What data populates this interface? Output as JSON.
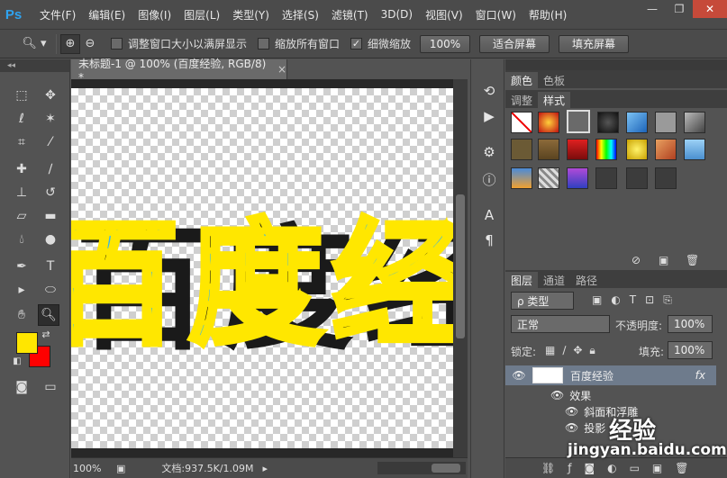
{
  "app": {
    "logo": "Ps",
    "menu": [
      "文件(F)",
      "编辑(E)",
      "图像(I)",
      "图层(L)",
      "类型(Y)",
      "选择(S)",
      "滤镜(T)",
      "3D(D)",
      "视图(V)",
      "窗口(W)",
      "帮助(H)"
    ],
    "window_controls": [
      "—",
      "❐",
      "✕"
    ]
  },
  "options": {
    "checkbox_resize": "调整窗口大小以满屏显示",
    "checkbox_all_windows": "缩放所有窗口",
    "checkbox_scrubby": "细微缩放",
    "btn_100": "100%",
    "btn_fit": "适合屏幕",
    "btn_fill": "填充屏幕"
  },
  "document": {
    "tab_title": "未标题-1 @ 100% (百度经验, RGB/8) *",
    "tab_close": "×",
    "canvas_text": "百度经验",
    "status_zoom": "100%",
    "status_doc": "文档:937.5K/1.09M"
  },
  "panels": {
    "color_tabs": [
      "颜色",
      "色板"
    ],
    "style_tabs": [
      "调整",
      "样式"
    ],
    "layers_tabs": [
      "图层",
      "通道",
      "路径"
    ],
    "filter_kind": "ρ 类型",
    "blend_mode": "正常",
    "opacity_label": "不透明度:",
    "opacity_value": "100%",
    "lock_label": "锁定:",
    "fill_label": "填充:",
    "fill_value": "100%",
    "layer_name": "百度经验",
    "layer_fx": "fx",
    "effects_label": "效果",
    "effect_bevel": "斜面和浮雕",
    "effect_shadow": "投影"
  },
  "watermark": {
    "brand": "经验",
    "url": "jingyan.baidu.com"
  }
}
